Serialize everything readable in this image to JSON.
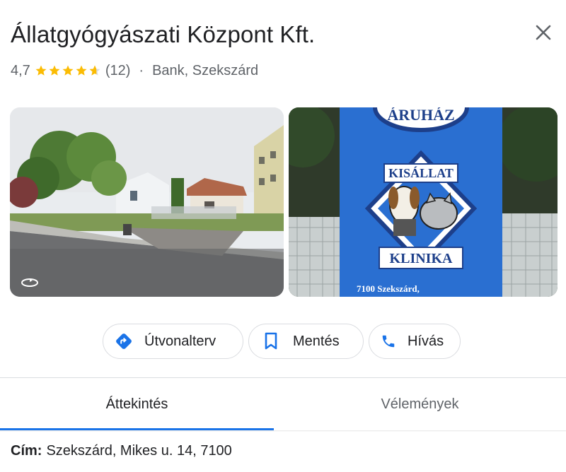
{
  "place": {
    "title": "Állatgyógyászati Központ Kft.",
    "rating": "4,7",
    "stars_value": 4.7,
    "stars_max": 5,
    "review_count": "(12)",
    "separator": "·",
    "category_location": "Bank, Szekszárd"
  },
  "photos": {
    "left_icon": "street-view-360-icon",
    "right_sign": {
      "top_text": "ÁRUHÁZ",
      "line1": "KISÁLLAT",
      "line2": "KLINIKA",
      "bottom_text": "7100 Szekszárd,"
    }
  },
  "actions": [
    {
      "label": "Útvonalterv",
      "icon": "directions-icon"
    },
    {
      "label": "Mentés",
      "icon": "bookmark-icon"
    },
    {
      "label": "Hívás",
      "icon": "phone-icon"
    }
  ],
  "tabs": [
    {
      "label": "Áttekintés",
      "selected": true
    },
    {
      "label": "Vélemények",
      "selected": false
    }
  ],
  "address": {
    "label": "Cím:",
    "value": "Szekszárd, Mikes u. 14, 7100"
  },
  "colors": {
    "accent": "#1a73e8",
    "star": "#fbbc04",
    "text": "#202124",
    "muted": "#5f6368",
    "border": "#dadce0",
    "sign_blue": "#2a6fd1"
  }
}
